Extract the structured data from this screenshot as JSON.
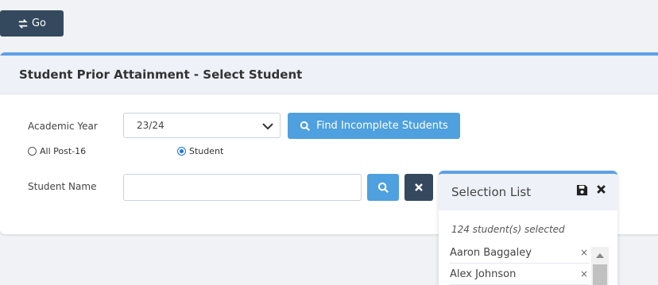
{
  "toolbar": {
    "go_label": "Go"
  },
  "panel": {
    "title": "Student Prior Attainment - Select Student",
    "academic_year_label": "Academic Year",
    "academic_year_value": "23/24",
    "find_button_label": "Find Incomplete Students",
    "radio_all_label": "All Post-16",
    "radio_student_label": "Student",
    "student_name_label": "Student Name",
    "student_name_value": ""
  },
  "selection_list": {
    "title": "Selection List",
    "count_text": "124 student(s) selected",
    "items": [
      {
        "name": "Aaron Baggaley",
        "remove": "×"
      },
      {
        "name": "Alex Johnson",
        "remove": "×"
      }
    ]
  },
  "colors": {
    "dark": "#34495e",
    "accent": "#4fa0de",
    "border_accent": "#5ea1e6"
  }
}
